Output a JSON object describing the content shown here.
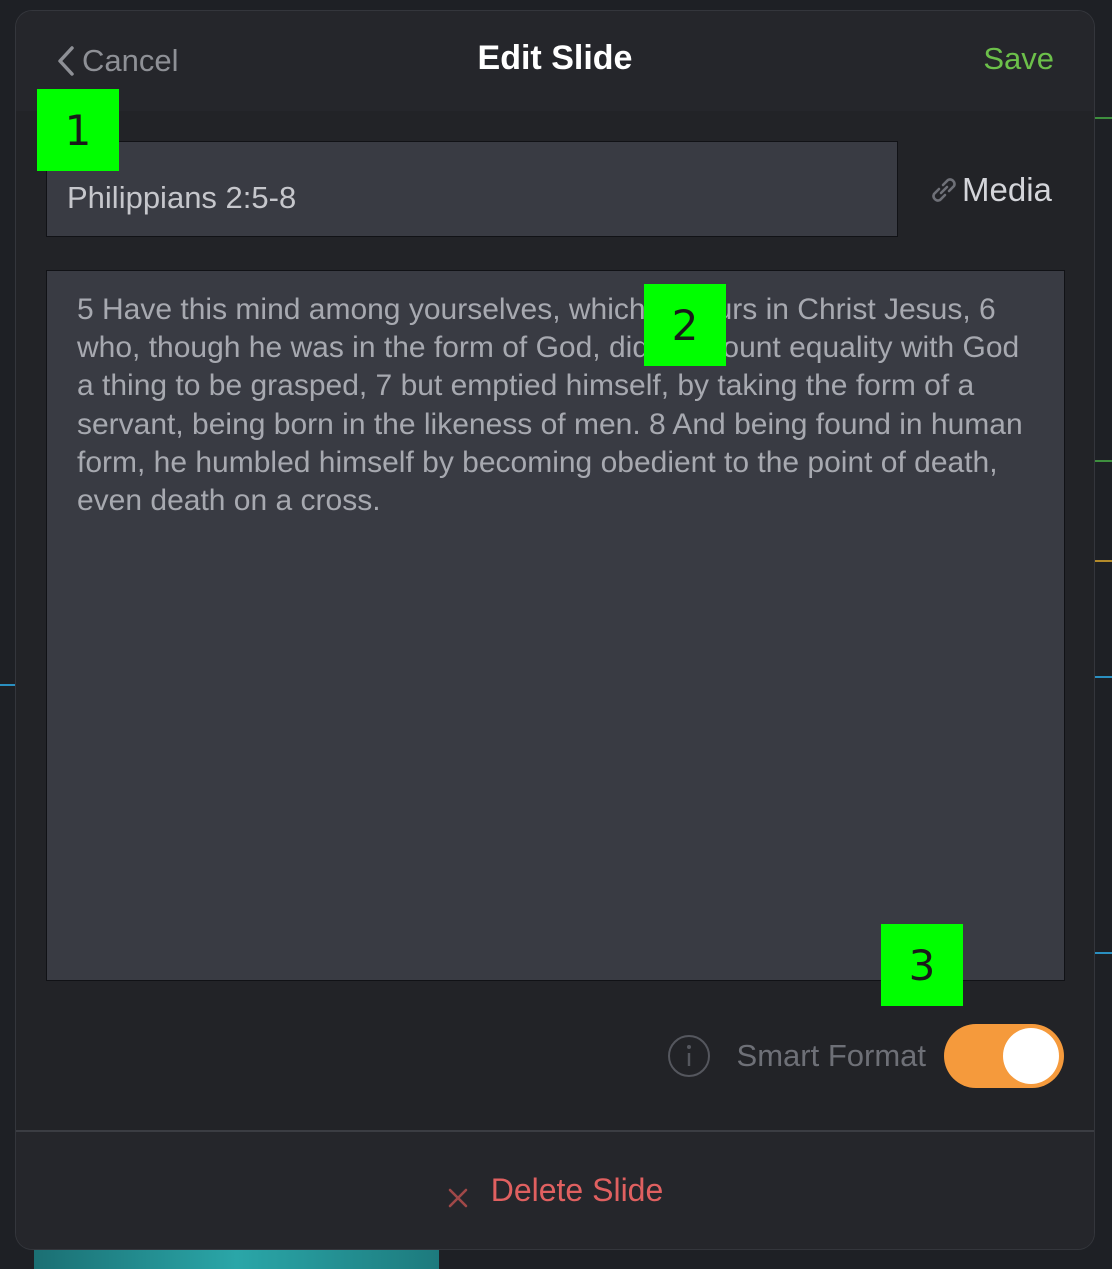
{
  "header": {
    "cancel_label": "Cancel",
    "title": "Edit Slide",
    "save_label": "Save"
  },
  "slide": {
    "title_value": "Philippians 2:5-8",
    "media_label": "Media",
    "body_text": "5 Have this mind among yourselves, which is yours in Christ Jesus, 6 who, though he was in the form of God, did not count equality with God a thing to be grasped, 7 but emptied himself, by taking the form of a servant, being born in the likeness of men. 8 And being found in human form, he humbled himself by becoming obedient to the point of death, even death on a cross."
  },
  "smart_format": {
    "label": "Smart Format",
    "enabled": true
  },
  "footer": {
    "delete_label": "Delete Slide"
  },
  "annotations": {
    "one": "1",
    "two": "2",
    "three": "3"
  },
  "colors": {
    "save": "#6cc04a",
    "toggle_on": "#f59a3c",
    "delete": "#e06060",
    "annotation": "#00ff00"
  },
  "icons": {
    "back": "chevron-left-icon",
    "media": "link-icon",
    "info": "info-icon",
    "delete": "close-icon"
  }
}
